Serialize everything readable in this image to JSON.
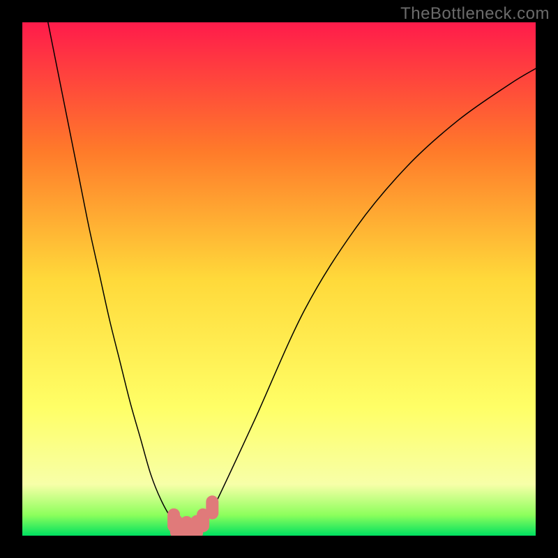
{
  "watermark": {
    "text": "TheBottleneck.com"
  },
  "colors": {
    "bg_black": "#000000",
    "curve": "#000000",
    "marker": "#e07a7a",
    "gradient_top": "#ff1b4b",
    "gradient_mid_upper": "#ff7a2a",
    "gradient_mid": "#ffd93a",
    "gradient_mid_lower": "#ffff66",
    "gradient_lowlight": "#f7ffa8",
    "gradient_green_edge": "#8cff5c",
    "gradient_green": "#00e060"
  },
  "chart_data": {
    "type": "line",
    "title": "",
    "xlabel": "",
    "ylabel": "",
    "xlim": [
      0,
      100
    ],
    "ylim": [
      0,
      100
    ],
    "legend": false,
    "grid": false,
    "series": [
      {
        "name": "bottleneck-curve",
        "x": [
          5,
          7,
          9,
          11,
          13,
          15,
          17,
          19,
          21,
          23,
          25,
          27,
          29,
          31,
          33,
          35,
          37,
          45,
          55,
          65,
          75,
          85,
          95,
          100
        ],
        "y": [
          100,
          90,
          80,
          70,
          60,
          51,
          42,
          34,
          26,
          19,
          12,
          7,
          3.5,
          1.8,
          1.5,
          2.2,
          5,
          22,
          44,
          60,
          72,
          81,
          88,
          91
        ]
      }
    ],
    "markers": [
      {
        "name": "bottom-marker-left",
        "x": 29.5,
        "y": 3.0
      },
      {
        "name": "bottom-marker-mid1",
        "x": 30.0,
        "y": 1.8
      },
      {
        "name": "bottom-marker-mid2",
        "x": 32.0,
        "y": 1.5
      },
      {
        "name": "bottom-marker-mid3",
        "x": 34.0,
        "y": 1.7
      },
      {
        "name": "bottom-marker-right",
        "x": 35.2,
        "y": 3.0
      },
      {
        "name": "right-marker",
        "x": 37.0,
        "y": 5.5
      }
    ],
    "background_gradient": {
      "type": "vertical-linear",
      "stops": [
        {
          "pct": 0,
          "color": "#ff1b4b"
        },
        {
          "pct": 25,
          "color": "#ff7a2a"
        },
        {
          "pct": 50,
          "color": "#ffd93a"
        },
        {
          "pct": 75,
          "color": "#ffff66"
        },
        {
          "pct": 90,
          "color": "#f7ffa8"
        },
        {
          "pct": 96,
          "color": "#8cff5c"
        },
        {
          "pct": 100,
          "color": "#00e060"
        }
      ]
    }
  }
}
